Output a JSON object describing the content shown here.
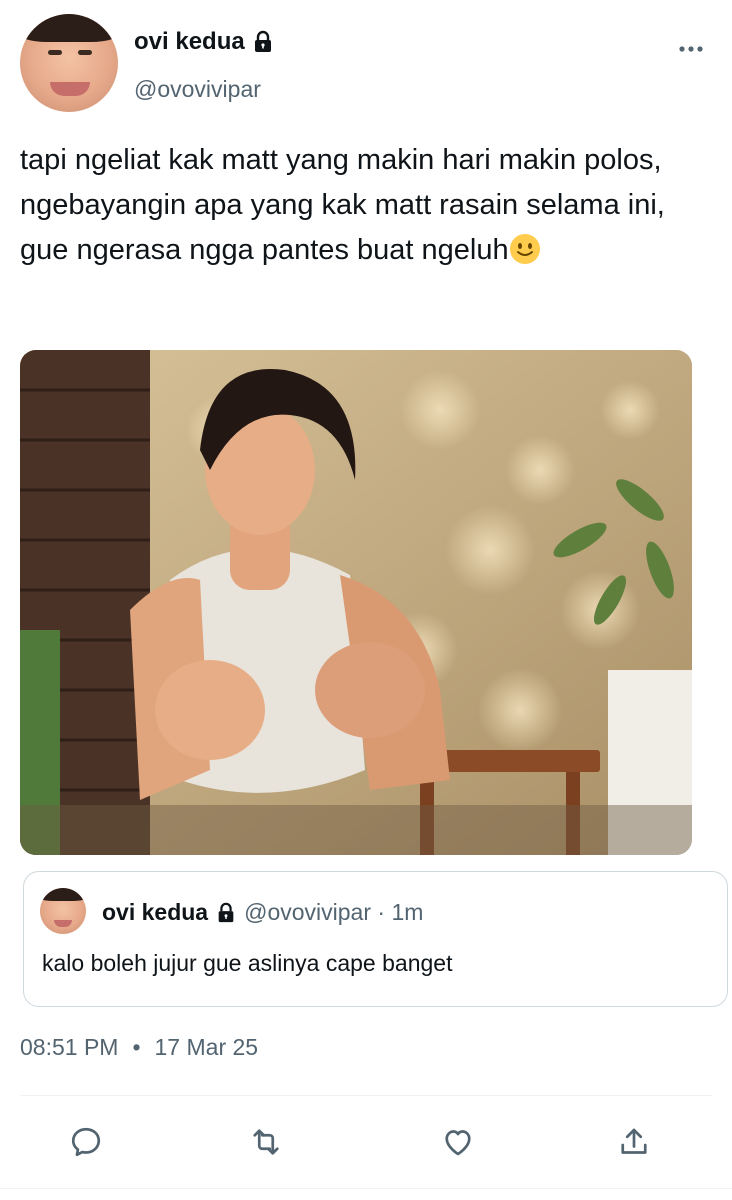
{
  "author": {
    "display_name": "ovi kedua",
    "handle": "@ovovivipar",
    "protected_icon": "lock-icon"
  },
  "tweet": {
    "text": "tapi ngeliat kak matt yang makin hari makin polos, ngebayangin apa yang kak matt rasain selama ini, gue ngerasa ngga pantes buat ngeluh",
    "emoji": "slightly-smiling-face",
    "media_icon": "photo"
  },
  "quoted_tweet": {
    "display_name": "ovi kedua",
    "handle_and_time": "@ovovivipar · 1m",
    "text": "kalo boleh jujur gue aslinya cape banget"
  },
  "meta": {
    "time": "08:51 PM",
    "separator": "•",
    "date": "17 Mar 25"
  },
  "actions": {
    "icons": [
      "reply-icon",
      "retweet-icon",
      "like-icon",
      "share-icon"
    ]
  },
  "colors": {
    "text_primary": "#0f1419",
    "text_secondary": "#536471",
    "border": "#cfd9de",
    "icon": "#536471"
  }
}
